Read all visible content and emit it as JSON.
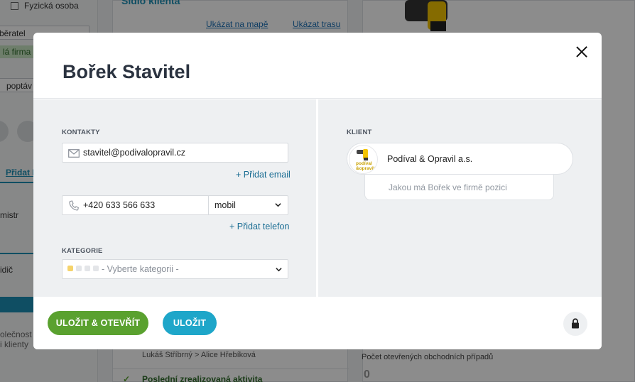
{
  "background": {
    "person_checkbox_label": "Fyzická osoba",
    "select_partial": "běratel",
    "green_tag_partial": "lá firma",
    "poptavka_partial": "poptáv",
    "pridat_partial": "Přidat K",
    "mistr_partial": "mistr",
    "ridic_partial": "idič",
    "spolecnost_partial": "olečnost",
    "klienty_partial": "i klienty",
    "header_partial": "Sídlo klienta",
    "map_link": "Ukázat na mapě",
    "route_link": "Ukázat trasu",
    "people_line": "Lukáš Stříbrný > Alice Hřebíková",
    "activity_line": "Poslední zrealizovaná aktivita",
    "open_cases_label": "Počet otevřených obchodních případů",
    "open_cases_value": "0"
  },
  "modal": {
    "title": "Bořek Stavitel",
    "contacts": {
      "section_label": "KONTAKTY",
      "email_value": "stavitel@podivalopravil.cz",
      "add_email": "+ Přidat email",
      "phone_value": "+420 633 566 633",
      "phone_type": "mobil",
      "add_phone": "+ Přidat telefon"
    },
    "category": {
      "section_label": "KATEGORIE",
      "placeholder": "- Vyberte kategorii -"
    },
    "client": {
      "section_label": "KLIENT",
      "name": "Podíval & Opravil a.s.",
      "logo_text_line1": "podíval",
      "logo_text_line2": "&opravil",
      "position_placeholder": "Jakou má Bořek ve firmě pozici"
    },
    "footer": {
      "save_open_label": "ULOŽIT & OTEVŘÍT",
      "save_label": "ULOŽIT"
    }
  },
  "colors": {
    "save_open_button": "#5aa12f",
    "save_button": "#1ea6c9",
    "link": "#1a6d93",
    "category_dot_active": "#f5d36b"
  },
  "icons": [
    "close-icon",
    "mail-icon",
    "phone-icon",
    "chevron-down-icon",
    "lock-icon",
    "drill-logo-icon"
  ]
}
